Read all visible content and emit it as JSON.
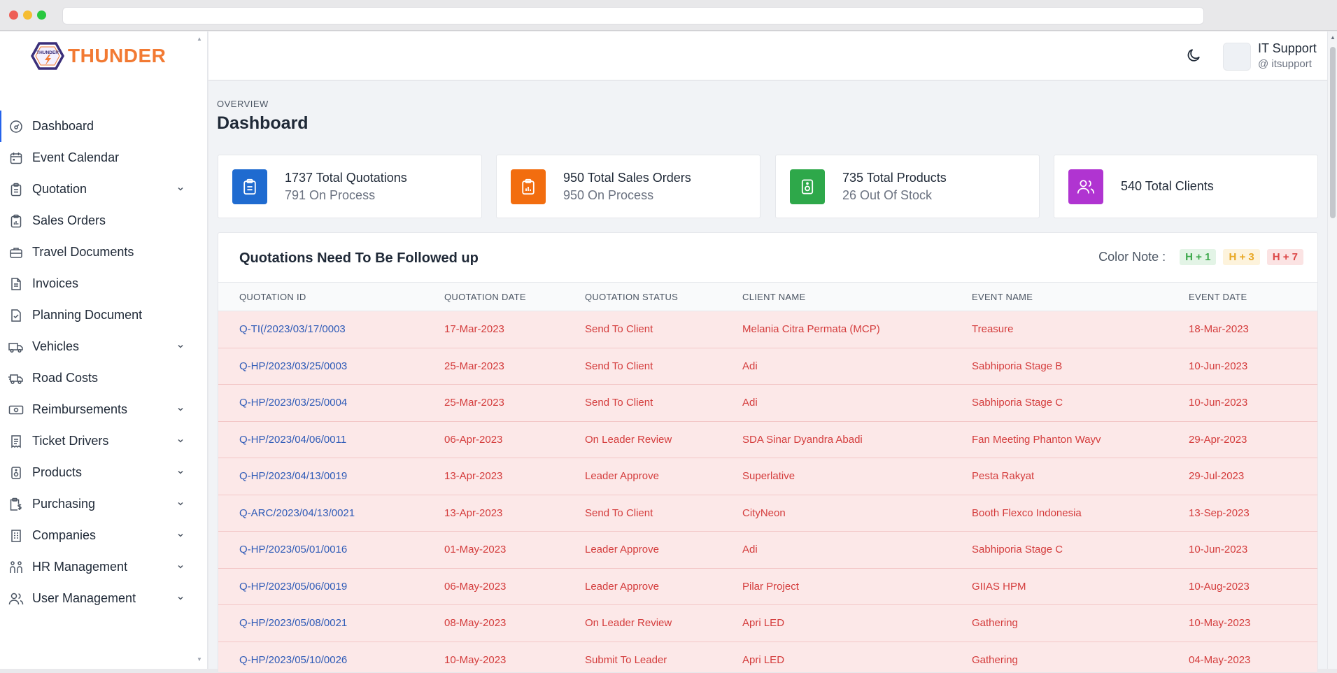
{
  "app": {
    "logo_text": "THUNDER",
    "logo_badge_text": "THUNDER"
  },
  "sidebar": {
    "items": [
      {
        "label": "Dashboard",
        "icon": "gauge-icon",
        "expandable": false,
        "active": true
      },
      {
        "label": "Event Calendar",
        "icon": "calendar-icon",
        "expandable": false
      },
      {
        "label": "Quotation",
        "icon": "clipboard-list-icon",
        "expandable": true
      },
      {
        "label": "Sales Orders",
        "icon": "clipboard-chart-icon",
        "expandable": false
      },
      {
        "label": "Travel Documents",
        "icon": "briefcase-icon",
        "expandable": false
      },
      {
        "label": "Invoices",
        "icon": "file-text-icon",
        "expandable": false
      },
      {
        "label": "Planning Document",
        "icon": "file-check-icon",
        "expandable": false
      },
      {
        "label": "Vehicles",
        "icon": "truck-icon",
        "expandable": true
      },
      {
        "label": "Road Costs",
        "icon": "truck-fast-icon",
        "expandable": false
      },
      {
        "label": "Reimbursements",
        "icon": "cash-icon",
        "expandable": true
      },
      {
        "label": "Ticket Drivers",
        "icon": "receipt-icon",
        "expandable": true
      },
      {
        "label": "Products",
        "icon": "speaker-icon",
        "expandable": true
      },
      {
        "label": "Purchasing",
        "icon": "clipboard-dollar-icon",
        "expandable": true
      },
      {
        "label": "Companies",
        "icon": "building-icon",
        "expandable": true
      },
      {
        "label": "HR Management",
        "icon": "people-icon",
        "expandable": true
      },
      {
        "label": "User Management",
        "icon": "users-icon",
        "expandable": true
      }
    ]
  },
  "header": {
    "user_name": "IT Support",
    "user_handle": "@ itsupport"
  },
  "page": {
    "overline": "OVERVIEW",
    "title": "Dashboard"
  },
  "stats": [
    {
      "main": "1737 Total Quotations",
      "sub": "791 On Process",
      "icon": "clipboard-list-icon",
      "color": "#1f6bd0"
    },
    {
      "main": "950 Total Sales Orders",
      "sub": "950 On Process",
      "icon": "clipboard-chart-icon",
      "color": "#f26d0f"
    },
    {
      "main": "735 Total Products",
      "sub": "26 Out Of Stock",
      "icon": "speaker-icon",
      "color": "#2ea84a"
    },
    {
      "main": "540 Total Clients",
      "sub": "",
      "icon": "users-icon",
      "color": "#b034d1"
    }
  ],
  "followup": {
    "title": "Quotations Need To Be Followed up",
    "color_note_label": "Color Note :",
    "chips": [
      {
        "label": "H + 1",
        "tone": "green"
      },
      {
        "label": "H + 3",
        "tone": "yellow"
      },
      {
        "label": "H + 7",
        "tone": "red"
      }
    ],
    "columns": [
      "QUOTATION ID",
      "QUOTATION DATE",
      "QUOTATION STATUS",
      "CLIENT NAME",
      "EVENT NAME",
      "EVENT DATE"
    ],
    "rows": [
      [
        "Q-TI(/2023/03/17/0003",
        "17-Mar-2023",
        "Send To Client",
        "Melania Citra Permata (MCP)",
        "Treasure",
        "18-Mar-2023"
      ],
      [
        "Q-HP/2023/03/25/0003",
        "25-Mar-2023",
        "Send To Client",
        "Adi",
        "Sabhiporia Stage B",
        "10-Jun-2023"
      ],
      [
        "Q-HP/2023/03/25/0004",
        "25-Mar-2023",
        "Send To Client",
        "Adi",
        "Sabhiporia Stage C",
        "10-Jun-2023"
      ],
      [
        "Q-HP/2023/04/06/0011",
        "06-Apr-2023",
        "On Leader Review",
        "SDA Sinar Dyandra Abadi",
        "Fan Meeting Phanton Wayv",
        "29-Apr-2023"
      ],
      [
        "Q-HP/2023/04/13/0019",
        "13-Apr-2023",
        "Leader Approve",
        "Superlative",
        "Pesta Rakyat",
        "29-Jul-2023"
      ],
      [
        "Q-ARC/2023/04/13/0021",
        "13-Apr-2023",
        "Send To Client",
        "CityNeon",
        "Booth Flexco Indonesia",
        "13-Sep-2023"
      ],
      [
        "Q-HP/2023/05/01/0016",
        "01-May-2023",
        "Leader Approve",
        "Adi",
        "Sabhiporia Stage C",
        "10-Jun-2023"
      ],
      [
        "Q-HP/2023/05/06/0019",
        "06-May-2023",
        "Leader Approve",
        "Pilar Project",
        "GIIAS HPM",
        "10-Aug-2023"
      ],
      [
        "Q-HP/2023/05/08/0021",
        "08-May-2023",
        "On Leader Review",
        "Apri LED",
        "Gathering",
        "10-May-2023"
      ],
      [
        "Q-HP/2023/05/10/0026",
        "10-May-2023",
        "Submit To Leader",
        "Apri LED",
        "Gathering",
        "04-May-2023"
      ]
    ]
  }
}
